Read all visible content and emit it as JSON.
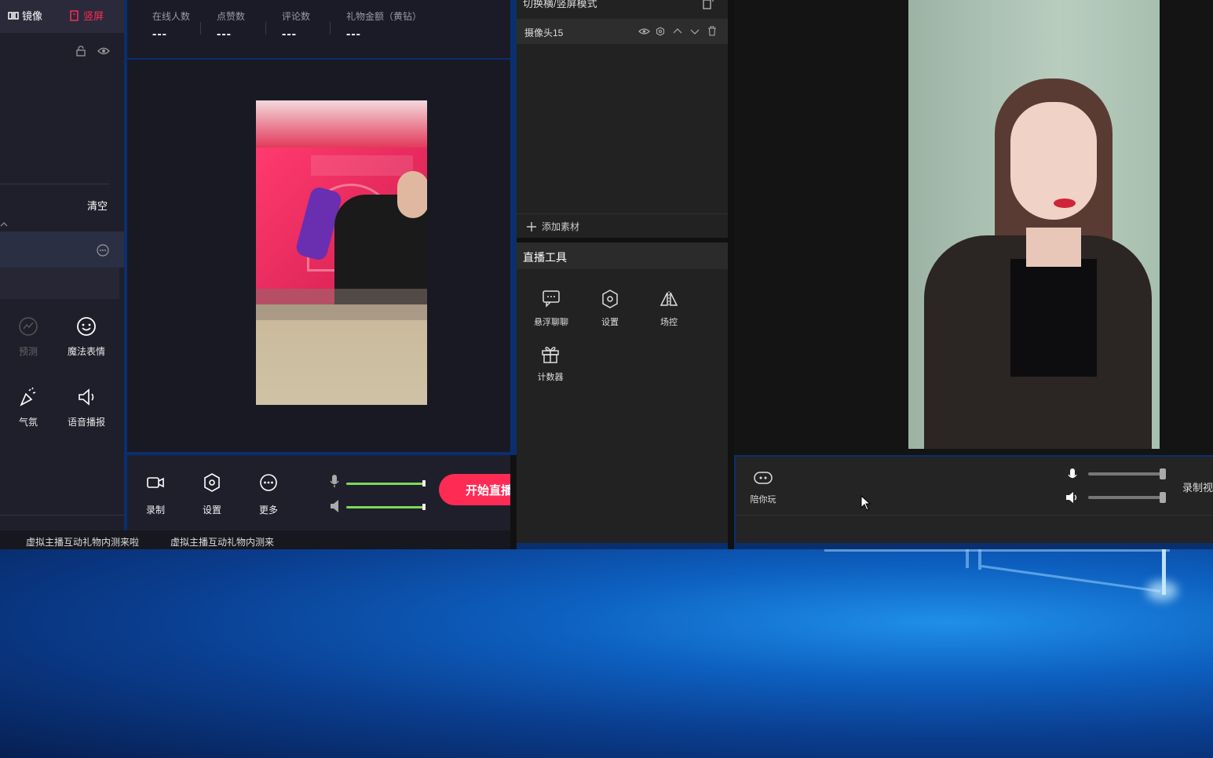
{
  "left": {
    "tab_mirror": "镜像",
    "tab_vertical": "竖屏",
    "clear": "清空",
    "tools": [
      {
        "label": "预测",
        "icon": "trend-icon",
        "enabled": false
      },
      {
        "label": "魔法表情",
        "icon": "smile-icon",
        "enabled": true
      },
      {
        "label": "气氛",
        "icon": "party-icon",
        "enabled": true
      },
      {
        "label": "语音播报",
        "icon": "speaker-icon",
        "enabled": true
      }
    ]
  },
  "stats": [
    {
      "label": "在线人数",
      "value": "---"
    },
    {
      "label": "点赞数",
      "value": "---"
    },
    {
      "label": "评论数",
      "value": "---"
    },
    {
      "label": "礼物金额（黄钻）",
      "value": "---"
    }
  ],
  "bottom": {
    "record": "录制",
    "settings": "设置",
    "more": "更多",
    "start_live": "开始直播",
    "mic_level": 1.0,
    "speaker_level": 1.0
  },
  "status_strip": [
    "虚拟主播互动礼物内测来啦",
    "虚拟主播互动礼物内测来"
  ],
  "middle": {
    "title": "切换横/竖屏模式",
    "camera_name": "摄像头15",
    "add_material": "添加素材",
    "live_tools_title": "直播工具",
    "live_tools": [
      {
        "label": "悬浮聊聊",
        "icon": "chat-icon"
      },
      {
        "label": "设置",
        "icon": "hexagon-settings-icon"
      },
      {
        "label": "场控",
        "icon": "flip-icon"
      },
      {
        "label": "计数器",
        "icon": "gift-icon"
      }
    ]
  },
  "right": {
    "ride_label": "陪你玩",
    "record_label": "录制视",
    "mic_level": 1.0,
    "volume_level": 1.0
  },
  "colors": {
    "accent": "#fe2c55",
    "slider": "#7ed957",
    "panel": "#1f1f2c"
  }
}
